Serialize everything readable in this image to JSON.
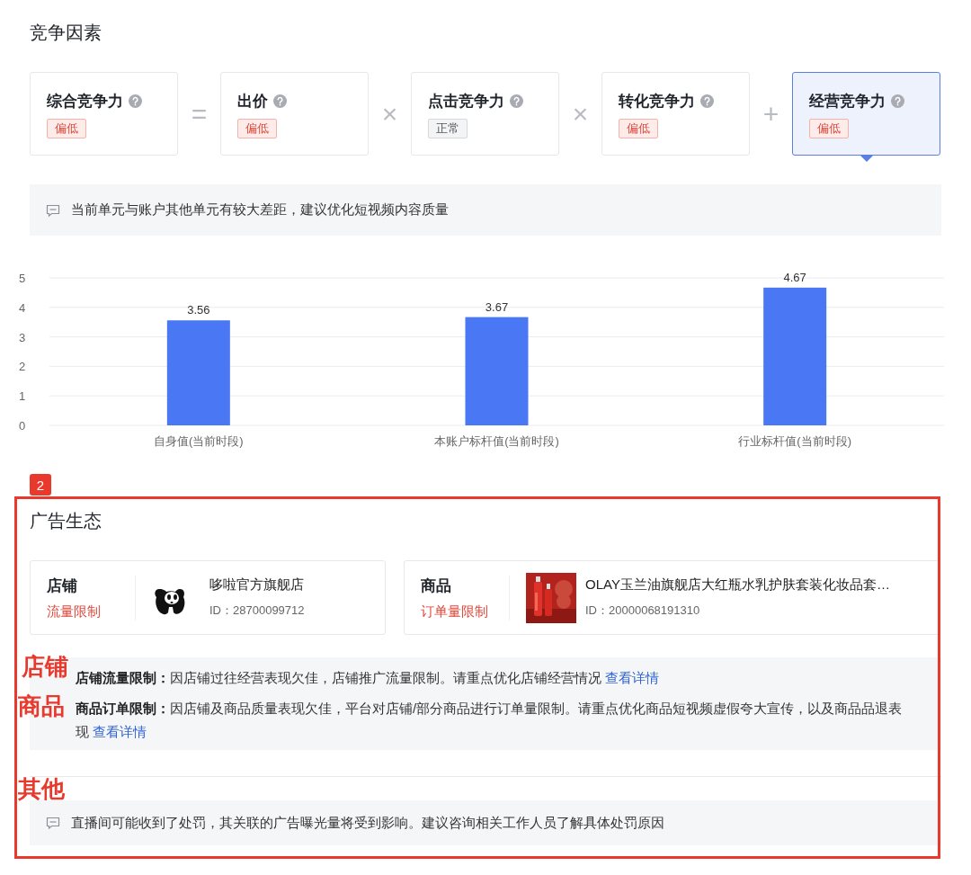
{
  "competition": {
    "title": "竞争因素",
    "factors": [
      {
        "name": "综合竞争力",
        "status": "偏低",
        "kind": "low",
        "selected": false
      },
      {
        "operator": "=",
        "name": "出价",
        "status": "偏低",
        "kind": "low",
        "selected": false
      },
      {
        "operator": "×",
        "name": "点击竞争力",
        "status": "正常",
        "kind": "normal",
        "selected": false
      },
      {
        "operator": "×",
        "name": "转化竞争力",
        "status": "偏低",
        "kind": "low",
        "selected": false
      },
      {
        "operator": "+",
        "name": "经营竞争力",
        "status": "偏低",
        "kind": "low",
        "selected": true
      }
    ],
    "note": "当前单元与账户其他单元有较大差距，建议优化短视频内容质量",
    "chart_data": {
      "type": "bar",
      "categories": [
        "自身值(当前时段)",
        "本账户标杆值(当前时段)",
        "行业标杆值(当前时段)"
      ],
      "values": [
        3.56,
        3.67,
        4.67
      ],
      "ylim": [
        0,
        5
      ],
      "yticks": [
        0,
        1,
        2,
        3,
        4,
        5
      ],
      "grid": true,
      "data_labels": true
    }
  },
  "ecology": {
    "badge": "2",
    "title": "广告生态",
    "entities": [
      {
        "type": "店铺",
        "limit": "流量限制",
        "kind": "logo",
        "name": "哆啦官方旗舰店",
        "id": "ID：28700099712"
      },
      {
        "type": "商品",
        "limit": "订单量限制",
        "kind": "picture",
        "name": "OLAY玉兰油旗舰店大红瓶水乳护肤套装化妆品套…",
        "id": "ID：20000068191310"
      }
    ],
    "details": [
      {
        "label": "店铺流量限制：",
        "text": "因店铺过往经营表现欠佳，店铺推广流量限制。请重点优化店铺经营情况",
        "link": "查看详情"
      },
      {
        "label": "商品订单限制：",
        "text": "因店铺及商品质量表现欠佳，平台对店铺/部分商品进行订单量限制。请重点优化商品短视频虚假夸大宣传，以及商品品退表现",
        "link": "查看详情"
      }
    ],
    "other_note": "直播间可能收到了处罚，其关联的广告曝光量将受到影响。建议咨询相关工作人员了解具体处罚原因",
    "annotations": [
      "店铺",
      "商品",
      "其他"
    ]
  }
}
